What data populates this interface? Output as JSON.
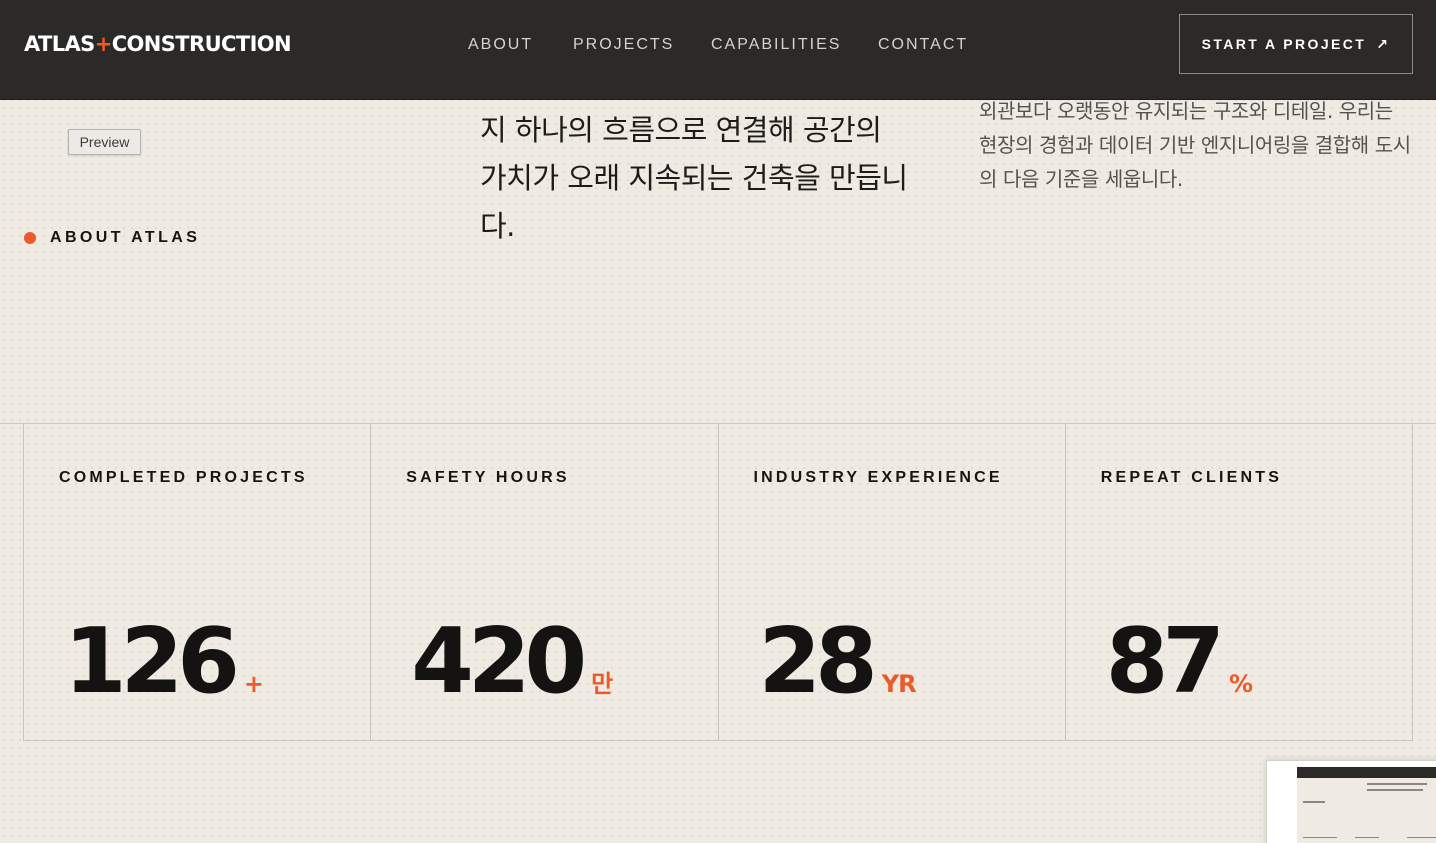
{
  "header": {
    "brand_a": "ATLAS",
    "brand_plus": "+",
    "brand_b": "CONSTRUCTION",
    "nav": [
      "ABOUT",
      "PROJECTS",
      "CAPABILITIES",
      "CONTACT"
    ],
    "cta_label": "START A PROJECT",
    "cta_icon": "↗"
  },
  "preview_chip": "Preview",
  "about": {
    "label": "ABOUT ATLAS",
    "lead": "지 하나의 흐름으로 연결해 공간의 가치가 오래 지속되는 건축을 만듭니다.",
    "sub": "외관보다 오랫동안 유지되는 구조와 디테일. 우리는 현장의 경험과 데이터 기반 엔지니어링을 결합해 도시의 다음 기준을 세웁니다."
  },
  "stats": [
    {
      "label": "COMPLETED PROJECTS",
      "value": "126",
      "unit": "+"
    },
    {
      "label": "SAFETY HOURS",
      "value": "420",
      "unit": "만"
    },
    {
      "label": "INDUSTRY EXPERIENCE",
      "value": "28",
      "unit": "YR"
    },
    {
      "label": "REPEAT CLIENTS",
      "value": "87",
      "unit": "%"
    }
  ],
  "colors": {
    "accent": "#ea5a2a",
    "header_bg": "#2b2a28",
    "page_bg": "#efebe3",
    "ink": "#161513"
  }
}
